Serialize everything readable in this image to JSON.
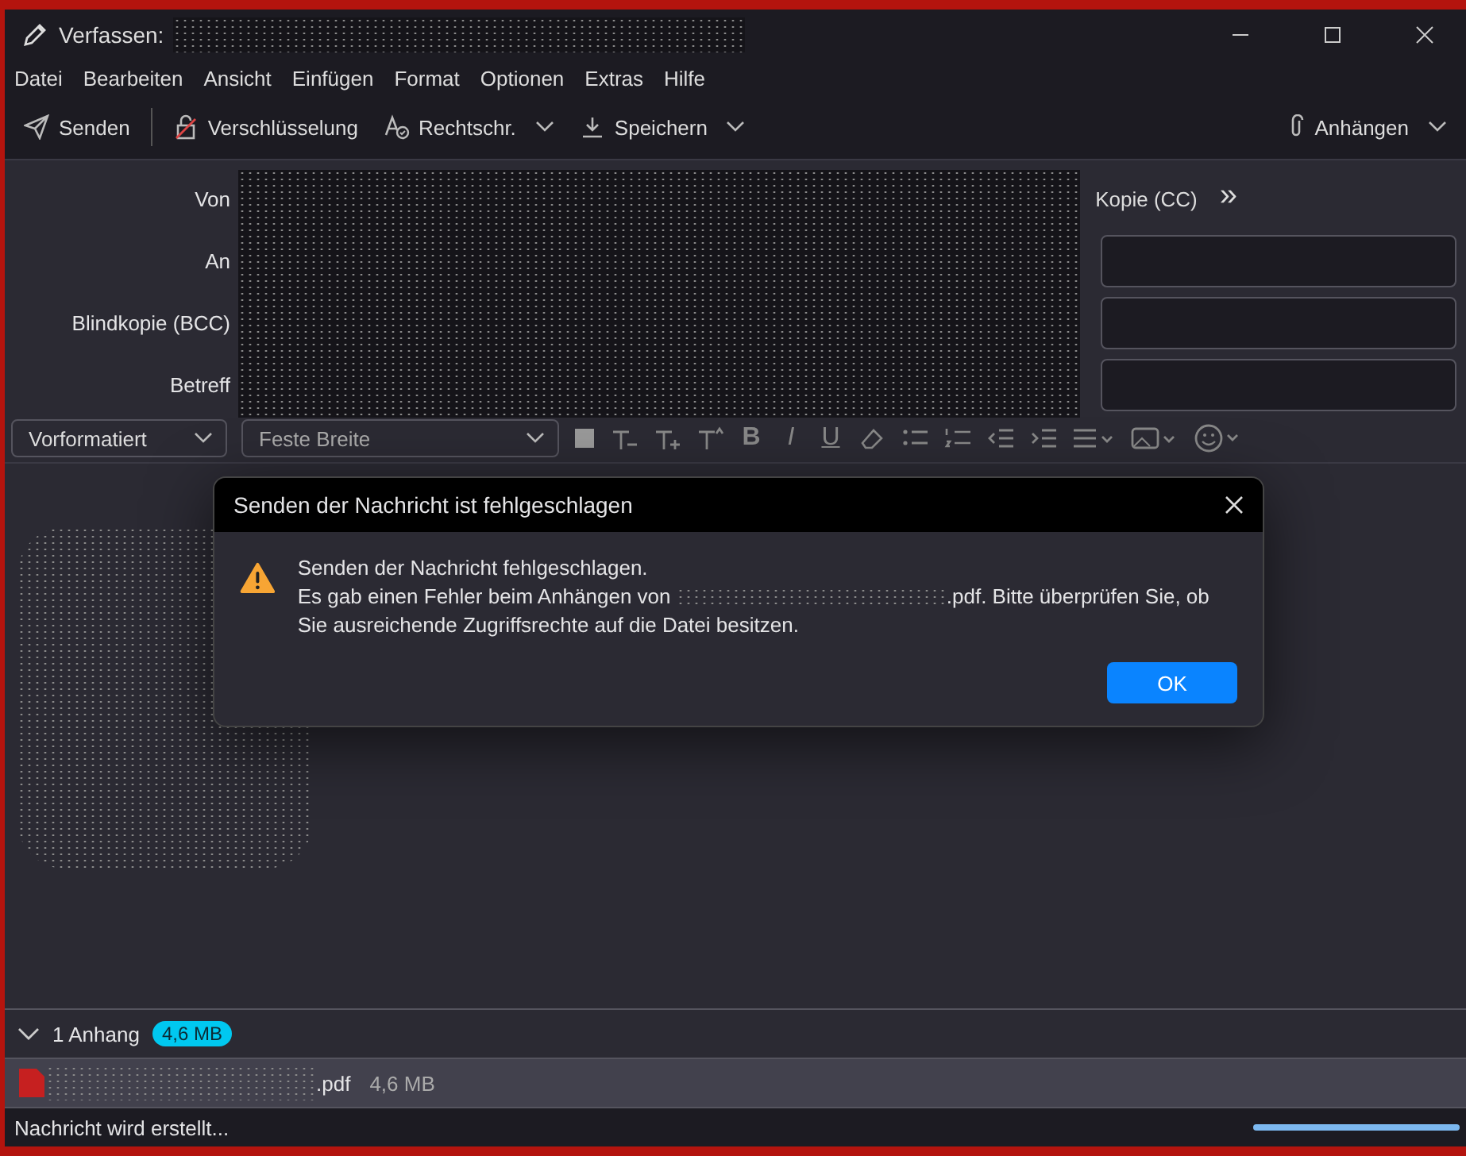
{
  "window": {
    "title": "Verfassen:"
  },
  "menu": [
    "Datei",
    "Bearbeiten",
    "Ansicht",
    "Einfügen",
    "Format",
    "Optionen",
    "Extras",
    "Hilfe"
  ],
  "toolbar": [
    {
      "kind": "send",
      "label": "Senden"
    },
    {
      "kind": "encrypt",
      "label": "Verschlüsselung"
    },
    {
      "kind": "spell",
      "label": "Rechtschr.",
      "dropdown": true
    },
    {
      "kind": "save",
      "label": "Speichern",
      "dropdown": true
    }
  ],
  "attach_button": {
    "label": "Anhängen",
    "dropdown": true
  },
  "headers": {
    "from_label": "Von",
    "cc_button": "Kopie (CC)",
    "more": "»",
    "fields": [
      {
        "label": "An"
      },
      {
        "label": "Blindkopie (BCC)"
      },
      {
        "label": "Betreff"
      }
    ]
  },
  "format_bar": {
    "paragraph": "Vorformatiert",
    "font": "Feste Breite",
    "bold": "B",
    "italic": "I",
    "underline": "U"
  },
  "attachments": {
    "expanded": true,
    "count_label": "1 Anhang",
    "total_size": "4,6 MB",
    "files": [
      {
        "name": ".pdf",
        "size": "4,6 MB"
      }
    ]
  },
  "status_bar": {
    "text": "Nachricht wird erstellt...",
    "progress": {
      "level": 1
    }
  },
  "dialog": {
    "title": "Senden der Nachricht ist fehlgeschlagen",
    "line_1": "Senden der Nachricht fehlgeschlagen.",
    "line_2_start": "Es gab einen Fehler beim Anhängen von",
    "line_2_end": ".pdf. Bitte überprüfen Sie, ob Sie ausreichende Zugriffsrechte auf die Datei besitzen.",
    "ok": "OK"
  }
}
